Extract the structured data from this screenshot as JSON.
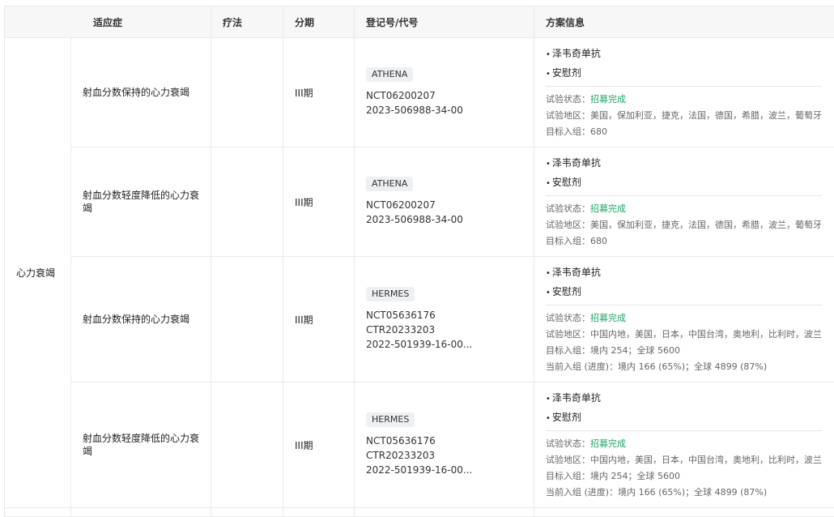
{
  "headers": {
    "indication": "适应症",
    "therapy": "疗法",
    "phase": "分期",
    "registry": "登记号/代号",
    "plan": "方案信息"
  },
  "group": "心力衰竭",
  "labels": {
    "status": "试验状态：",
    "region": "试验地区：",
    "target": "目标入组：",
    "current": "当前入组 (进度)："
  },
  "colors": {
    "status_green": "#1aa66a"
  },
  "rows": [
    {
      "indication": "射血分数保持的心力衰竭",
      "therapy": "",
      "phase": "III期",
      "tag": "ATHENA",
      "ids": [
        "NCT06200207",
        "2023-506988-34-00"
      ],
      "drugs": [
        "泽韦奇单抗",
        "安慰剂"
      ],
      "status": "招募完成",
      "region": "美国，保加利亚，捷克，法国，德国，希腊，波兰，葡萄牙",
      "target": "680",
      "current": ""
    },
    {
      "indication": "射血分数轻度降低的心力衰竭",
      "therapy": "",
      "phase": "III期",
      "tag": "ATHENA",
      "ids": [
        "NCT06200207",
        "2023-506988-34-00"
      ],
      "drugs": [
        "泽韦奇单抗",
        "安慰剂"
      ],
      "status": "招募完成",
      "region": "美国，保加利亚，捷克，法国，德国，希腊，波兰，葡萄牙",
      "target": "680",
      "current": ""
    },
    {
      "indication": "射血分数保持的心力衰竭",
      "therapy": "",
      "phase": "III期",
      "tag": "HERMES",
      "ids": [
        "NCT05636176",
        "CTR20233203",
        "2022-501939-16-00..."
      ],
      "drugs": [
        "泽韦奇单抗",
        "安慰剂"
      ],
      "status": "招募完成",
      "region": "中国内地，美国，日本，中国台湾，奥地利，比利时，波兰",
      "target": "境内 254；全球 5600",
      "current": "境内 166 (65%)；全球 4899 (87%)"
    },
    {
      "indication": "射血分数轻度降低的心力衰竭",
      "therapy": "",
      "phase": "III期",
      "tag": "HERMES",
      "ids": [
        "NCT05636176",
        "CTR20233203",
        "2022-501939-16-00..."
      ],
      "drugs": [
        "泽韦奇单抗",
        "安慰剂"
      ],
      "status": "招募完成",
      "region": "中国内地，美国，日本，中国台湾，奥地利，比利时，波兰",
      "target": "境内 254；全球 5600",
      "current": "境内 166 (65%)；全球 4899 (87%)"
    }
  ]
}
